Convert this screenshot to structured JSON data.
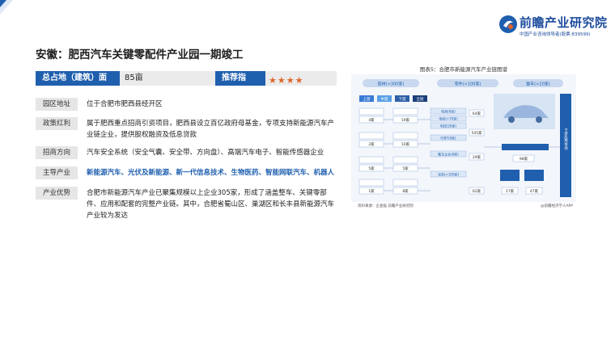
{
  "brand": {
    "name": "前瞻产业研究院",
    "tagline": "中国产业咨询领导者(股票:839599)",
    "primary_color": "#1f5fae",
    "accent_color": "#e0642a"
  },
  "title": "安徽：肥西汽车关键零配件产业园一期竣工",
  "stats": {
    "area_label": "总占地（建筑）面积：",
    "area_value": "85亩",
    "rating_label": "推荐指数：",
    "rating_stars": 4
  },
  "info": [
    {
      "label": "园区地址",
      "value": "位于合肥市肥西县经开区"
    },
    {
      "label": "政策红利",
      "value": "属于肥西重点招商引资项目，肥西县设立百亿政府母基金，专项支持新能源汽车产业链企业，提供股权融资及低息贷款"
    },
    {
      "label": "招商方向",
      "value": "汽车安全系统（安全气囊、安全带、方向盘）、高端汽车电子、智能传感器企业"
    },
    {
      "label": "主导产业",
      "value": "新能源汽车、光伏及新能源、新一代信息技术、生物医药、智能网联汽车、机器人"
    },
    {
      "label": "产业优势",
      "value": "合肥市新能源汽车产业已聚集规模以上企业305家，形成了涵盖整车、关键零部件、应用和配套的完整产业链。其中，合肥省蜀山区、巢湖区和长丰县新能源汽车产业较为发达"
    }
  ],
  "figure": {
    "title": "图表5：合肥市新能源汽车产业链图谱",
    "source": "资料来源：企查猫 前瞻产业研究院",
    "credit": "@前瞻经济学人APP",
    "top_pills": [
      "原材(>300家)",
      "零件(>100家)",
      "整车(>20家)"
    ],
    "tags": [
      "上游",
      "中游",
      "下游",
      "全链"
    ],
    "left_counts": [
      "4家",
      "2家",
      "5家",
      "1家"
    ],
    "mid_counts": [
      "19家",
      "10家",
      "5家",
      "8家"
    ],
    "right_counts": [
      "64家",
      "545家",
      "29家",
      "62家"
    ],
    "far_counts": [
      "98家",
      "17家",
      "47家"
    ],
    "right_label": "下游应用市场",
    "sub_labels": [
      "电池(6家)",
      "电机(>70家)",
      "电控(26家)",
      "IGBT(6家)",
      "整车企业(6家)",
      "充电(>100家)"
    ]
  }
}
